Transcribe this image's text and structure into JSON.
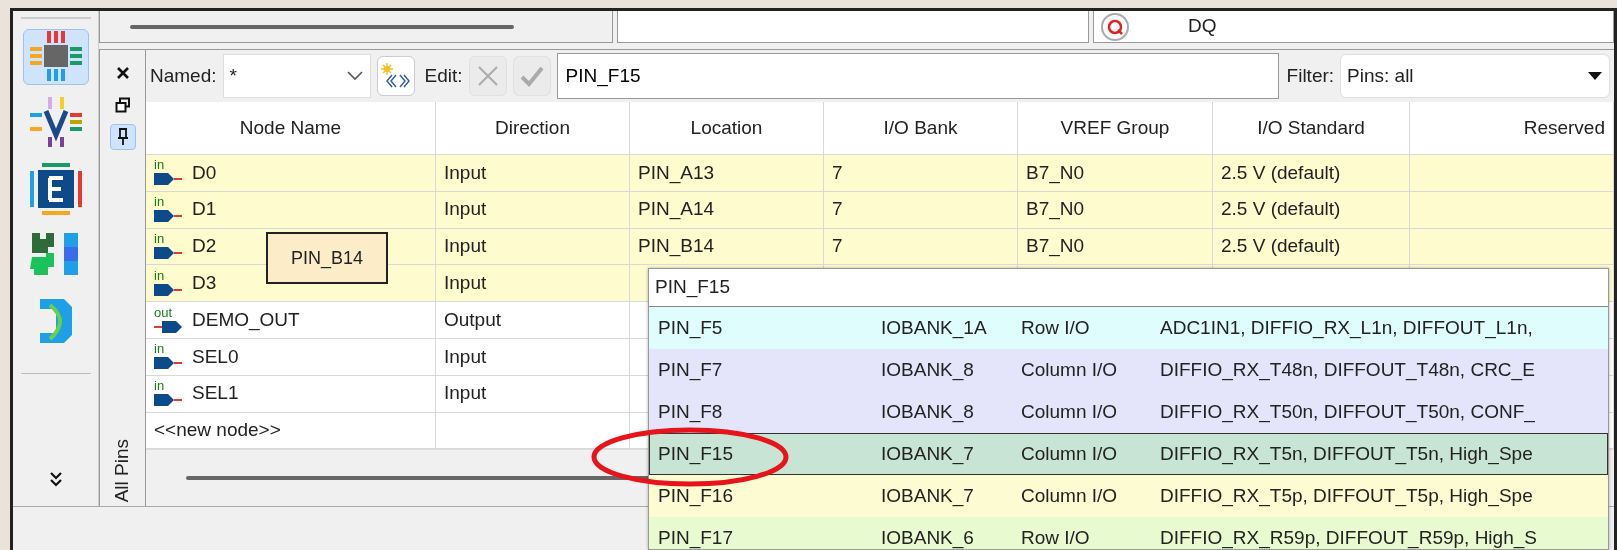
{
  "top_strip": {
    "search_value": "DQ"
  },
  "sidebar": {
    "items": [
      {
        "kind": "chip",
        "selected": true
      },
      {
        "kind": "v",
        "selected": false
      },
      {
        "kind": "e",
        "selected": false
      },
      {
        "kind": "puzzle",
        "selected": false
      },
      {
        "kind": "d",
        "selected": false
      }
    ]
  },
  "dock": {
    "tab_label": "All Pins",
    "pinned": true
  },
  "toolbar": {
    "named_label": "Named:",
    "named_value": "*",
    "edit_label": "Edit:",
    "edit_value": "PIN_F15",
    "filter_label": "Filter:",
    "filter_value": "Pins: all"
  },
  "table": {
    "columns": [
      "Node Name",
      "Direction",
      "Location",
      "I/O Bank",
      "VREF Group",
      "I/O Standard",
      "Reserved"
    ],
    "rows": [
      {
        "pin_tag": "in",
        "kind": "in",
        "name": "D0",
        "direction": "Input",
        "location": "PIN_A13",
        "io_bank": "7",
        "vref_group": "B7_N0",
        "io_standard": "2.5 V (default)",
        "assigned": true
      },
      {
        "pin_tag": "in",
        "kind": "in",
        "name": "D1",
        "direction": "Input",
        "location": "PIN_A14",
        "io_bank": "7",
        "vref_group": "B7_N0",
        "io_standard": "2.5 V (default)",
        "assigned": true
      },
      {
        "pin_tag": "in",
        "kind": "in",
        "name": "D2",
        "direction": "Input",
        "location": "PIN_B14",
        "io_bank": "7",
        "vref_group": "B7_N0",
        "io_standard": "2.5 V (default)",
        "assigned": true
      },
      {
        "pin_tag": "in",
        "kind": "in",
        "name": "D3",
        "direction": "Input",
        "assigned": true
      },
      {
        "pin_tag": "out",
        "kind": "out",
        "name": "DEMO_OUT",
        "direction": "Output",
        "assigned": false
      },
      {
        "pin_tag": "in",
        "kind": "in",
        "name": "SEL0",
        "direction": "Input",
        "assigned": false
      },
      {
        "pin_tag": "in",
        "kind": "in",
        "name": "SEL1",
        "direction": "Input",
        "assigned": false
      },
      {
        "kind": "new",
        "name": "<<new node>>",
        "assigned": false
      }
    ]
  },
  "tooltip": "PIN_B14",
  "location_popup": {
    "value": "PIN_F15",
    "items": [
      {
        "pin": "PIN_F5",
        "bank": "IOBANK_1A",
        "type": "Row I/O",
        "functions": "ADC1IN1, DIFFIO_RX_L1n, DIFFOUT_L1n,",
        "color": "#e0fdfd",
        "selected": false
      },
      {
        "pin": "PIN_F7",
        "bank": "IOBANK_8",
        "type": "Column I/O",
        "functions": "DIFFIO_RX_T48n, DIFFOUT_T48n, CRC_E",
        "color": "#e4e4fa",
        "selected": false
      },
      {
        "pin": "PIN_F8",
        "bank": "IOBANK_8",
        "type": "Column I/O",
        "functions": "DIFFIO_RX_T50n, DIFFOUT_T50n, CONF_",
        "color": "#e4e4fa",
        "selected": false
      },
      {
        "pin": "PIN_F15",
        "bank": "IOBANK_7",
        "type": "Column I/O",
        "functions": "DIFFIO_RX_T5n, DIFFOUT_T5n, High_Spe",
        "color": "#c8e4d4",
        "selected": true
      },
      {
        "pin": "PIN_F16",
        "bank": "IOBANK_7",
        "type": "Column I/O",
        "functions": "DIFFIO_RX_T5p, DIFFOUT_T5p, High_Spe",
        "color": "#fdfbd2",
        "selected": false
      },
      {
        "pin": "PIN_F17",
        "bank": "IOBANK_6",
        "type": "Row I/O",
        "functions": "DIFFIO_RX_R59p, DIFFOUT_R59p, High_S",
        "color": "#e8fbd0",
        "selected": false
      }
    ]
  }
}
